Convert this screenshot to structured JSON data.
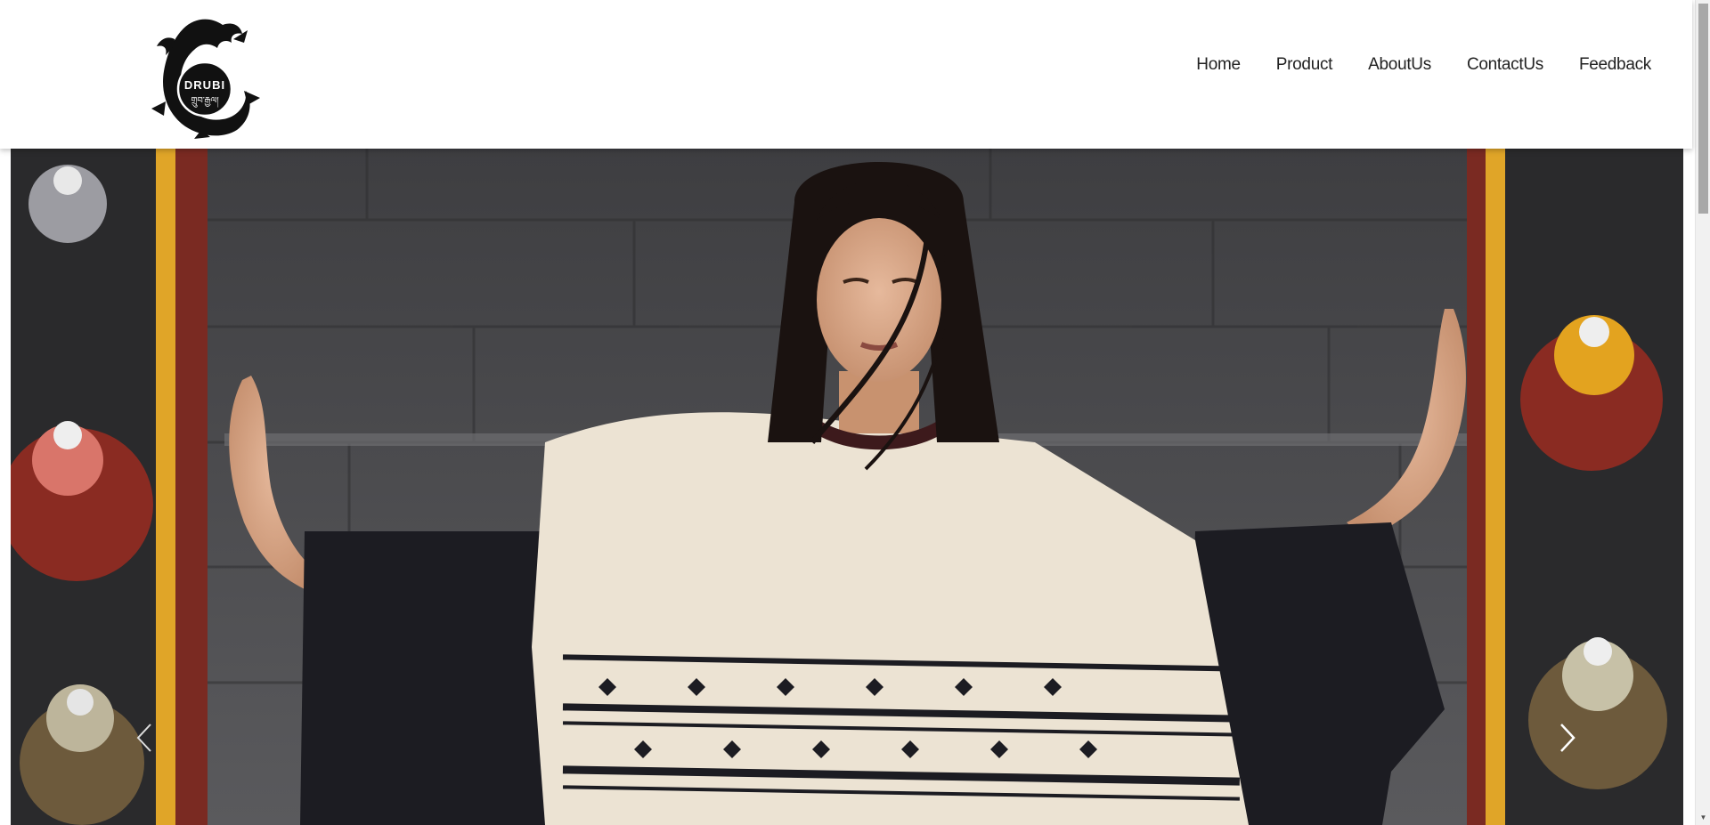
{
  "brand": {
    "logo_text_latin": "DRUBI",
    "logo_text_script": "གྲུབ་རྒྱལ།"
  },
  "nav": {
    "items": [
      {
        "label": "Home"
      },
      {
        "label": "Product"
      },
      {
        "label": "AboutUs"
      },
      {
        "label": "ContactUs"
      },
      {
        "label": "Feedback"
      }
    ]
  },
  "carousel": {
    "prev_icon": "chevron-left-icon",
    "next_icon": "chevron-right-icon"
  },
  "colors": {
    "header_bg": "#ffffff",
    "nav_text": "#222222",
    "wall": "#4a4a4c",
    "pillar_red": "#7a2a22",
    "pillar_yellow": "#e0a528",
    "garment_cream": "#ece3d3",
    "garment_black": "#1c1c22"
  }
}
